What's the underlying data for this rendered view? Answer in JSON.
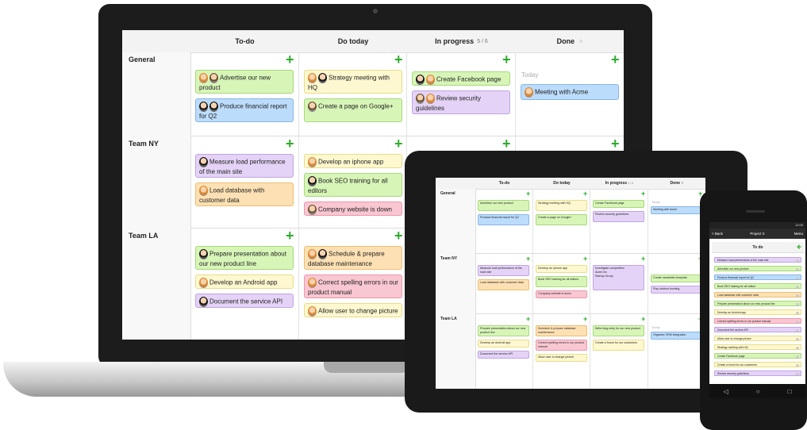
{
  "laptop": {
    "columns": [
      {
        "title": "To-do",
        "wip": ""
      },
      {
        "title": "Do today",
        "wip": ""
      },
      {
        "title": "In progress",
        "wip": "5 / 6"
      },
      {
        "title": "Done",
        "wip": ""
      }
    ],
    "lanes": [
      "General",
      "Team NY",
      "Team LA"
    ],
    "today_label": "Today",
    "cards": {
      "g1": "Advertise our new product",
      "g2": "Produce financial report for Q2",
      "g3": "Strategy meeting with HQ",
      "g4": "Create a page on Google+",
      "g5": "Create Facebook page",
      "g6": "Review security guidelines",
      "g7": "Meeting with Acme",
      "n1": "Measure load performance of the main site",
      "n2": "Load database with customer data",
      "n3": "Develop an iphone app",
      "n4": "Book SEO training for all editors",
      "n5": "Company website is down",
      "l1": "Prepare presentation about our new product line",
      "l2": "Develop an Android app",
      "l3": "Document the service API",
      "l4": "Schedule & prepare database maintenance",
      "l5": "Correct spelling errors in our product manual",
      "l6": "Allow user to change picture"
    }
  },
  "tablet": {
    "columns": [
      "To-do",
      "Do today",
      "In progress",
      "Done"
    ],
    "wip": "4 / 6",
    "lanes": [
      "General",
      "Team NY",
      "Team LA"
    ],
    "today_label": "Today",
    "cards": {
      "a1": "Advertise our new product",
      "a2": "Produce financial report for Q2",
      "a3": "Strategy meeting with HQ",
      "a4": "Create a page on Google+",
      "a5": "Create Facebook page",
      "a6": "Review security guidelines",
      "a7": "Meeting with Acme",
      "b1": "Measure load performance of the main site",
      "b2": "Load database with customer data",
      "b3": "Develop an iphone app",
      "b4": "Book SEO training for all editors",
      "b5": "Company website is down",
      "b6": "Investigate competition",
      "b7": "Acme Inc",
      "b8": "Startup Group",
      "b9": "Create newsletter template",
      "b10": "Play outdoor bowling",
      "c1": "Prepare presentation about our new product line",
      "c2": "Develop an Android app",
      "c3": "Document the service API",
      "c4": "Schedule & prepare database maintenance",
      "c5": "Correct spelling errors in our product manual",
      "c6": "Allow user to change picture",
      "c7": "Write blog entry for our new product",
      "c8": "Create a forum for our customers",
      "c9": "Organize CRM integration"
    }
  },
  "phone": {
    "status": "12:00",
    "back_label": "< Back",
    "project": "Project X",
    "menu_label": "Menu",
    "column": "To do",
    "items": [
      "Measure load performance of the main site",
      "Advertise our new product",
      "Produce financial report for Q2",
      "Book SEO training for all editors",
      "Load database with customer data",
      "Prepare presentation about our new product line",
      "Develop an Android app",
      "Correct spelling errors in our product manual",
      "Document the service API",
      "Allow user to change picture",
      "Strategy meeting with HQ",
      "Create Facebook page",
      "Create a forum for our customers",
      "Review security guidelines"
    ],
    "nav": [
      "◁",
      "○",
      "□"
    ]
  },
  "colors": {
    "green": "#d8f5b8",
    "blue": "#bcdcfb",
    "purple": "#e4d3f6",
    "orange": "#fde1b4",
    "yellow": "#fdf8cf",
    "pink": "#f9c7d2",
    "plus": "#2eab2e"
  }
}
